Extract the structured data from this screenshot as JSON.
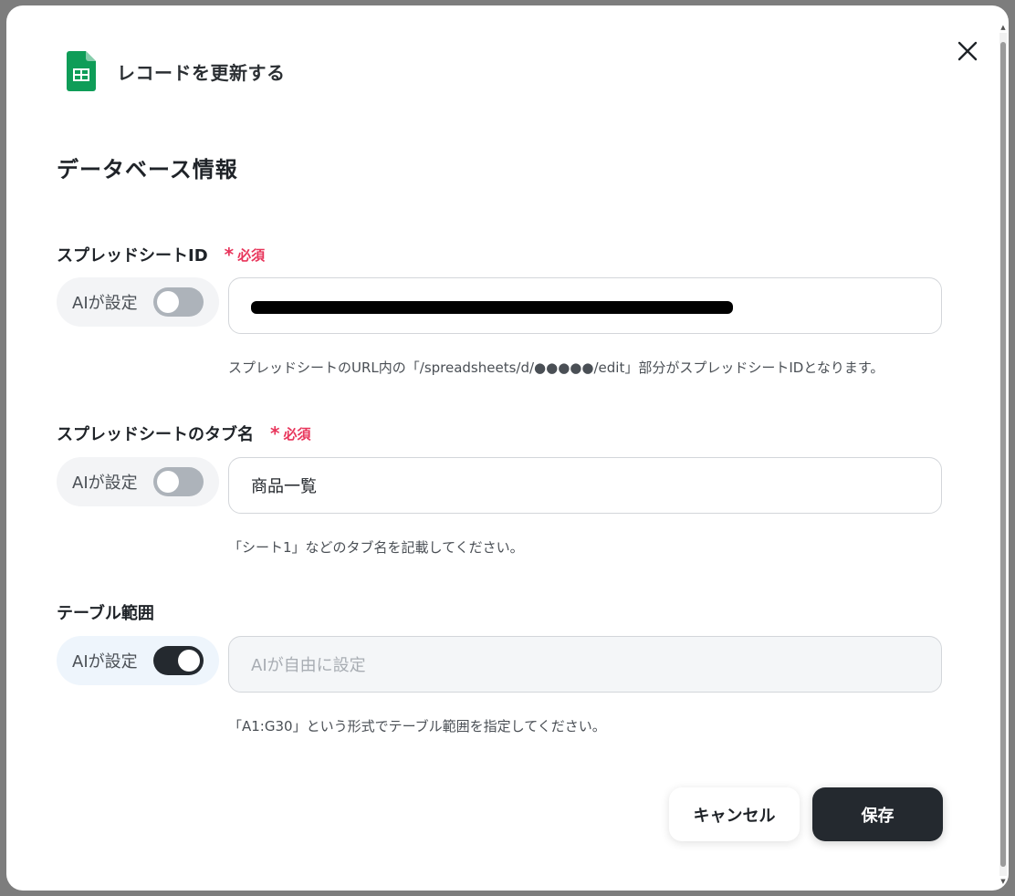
{
  "dialog": {
    "title": "レコードを更新する",
    "section_title": "データベース情報",
    "cancel_label": "キャンセル",
    "save_label": "保存"
  },
  "fields": [
    {
      "label": "スプレッドシートID",
      "required": "必須",
      "ai_label": "AIが設定",
      "ai_enabled": false,
      "value": "",
      "value_redacted": true,
      "helper": "スプレッドシートのURL内の「/spreadsheets/d/●●●●●/edit」部分がスプレッドシートIDとなります。"
    },
    {
      "label": "スプレッドシートのタブ名",
      "required": "必須",
      "ai_label": "AIが設定",
      "ai_enabled": false,
      "value": "商品一覧",
      "helper": "「シート1」などのタブ名を記載してください。"
    },
    {
      "label": "テーブル範囲",
      "ai_label": "AIが設定",
      "ai_enabled": true,
      "placeholder": "AIが自由に設定",
      "helper": "「A1:G30」という形式でテーブル範囲を指定してください。"
    }
  ],
  "colors": {
    "required": "#e8355b",
    "toggle_on": "#24292f",
    "toggle_off": "#adb3ba",
    "save_button": "#24292f",
    "sheets_green": "#0f9d58"
  }
}
